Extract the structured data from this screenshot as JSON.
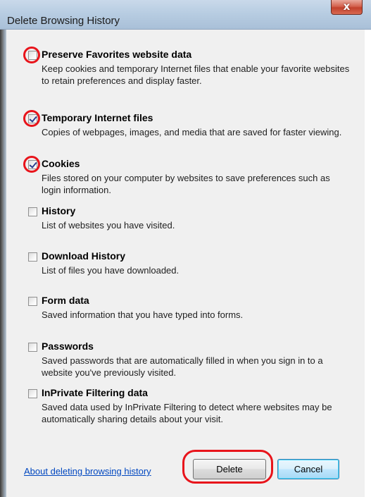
{
  "window": {
    "title": "Delete Browsing History",
    "close_glyph": "x"
  },
  "options": [
    {
      "title": "Preserve Favorites website data",
      "description": "Keep cookies and temporary Internet files that enable your favorite websites to retain preferences and display faster.",
      "checked": false,
      "highlighted": true
    },
    {
      "title": "Temporary Internet files",
      "description": "Copies of webpages, images, and media that are saved for faster viewing.",
      "checked": true,
      "highlighted": true
    },
    {
      "title": "Cookies",
      "description": "Files stored on your computer by websites to save preferences such as login information.",
      "checked": true,
      "highlighted": true
    },
    {
      "title": "History",
      "description": "List of websites you have visited.",
      "checked": false,
      "highlighted": false
    },
    {
      "title": "Download History",
      "description": "List of files you have downloaded.",
      "checked": false,
      "highlighted": false
    },
    {
      "title": "Form data",
      "description": "Saved information that you have typed into forms.",
      "checked": false,
      "highlighted": false
    },
    {
      "title": "Passwords",
      "description": "Saved passwords that are automatically filled in when you sign in to a website you've previously visited.",
      "checked": false,
      "highlighted": false
    },
    {
      "title": "InPrivate Filtering data",
      "description": "Saved data used by InPrivate Filtering to detect where websites may be automatically sharing details about your visit.",
      "checked": false,
      "highlighted": false
    }
  ],
  "footer": {
    "help_link": "About deleting browsing history",
    "delete_label": "Delete",
    "cancel_label": "Cancel"
  },
  "colors": {
    "highlight_ring": "#e8141b",
    "link": "#0047c0",
    "checkmark": "#2b3f8c"
  }
}
